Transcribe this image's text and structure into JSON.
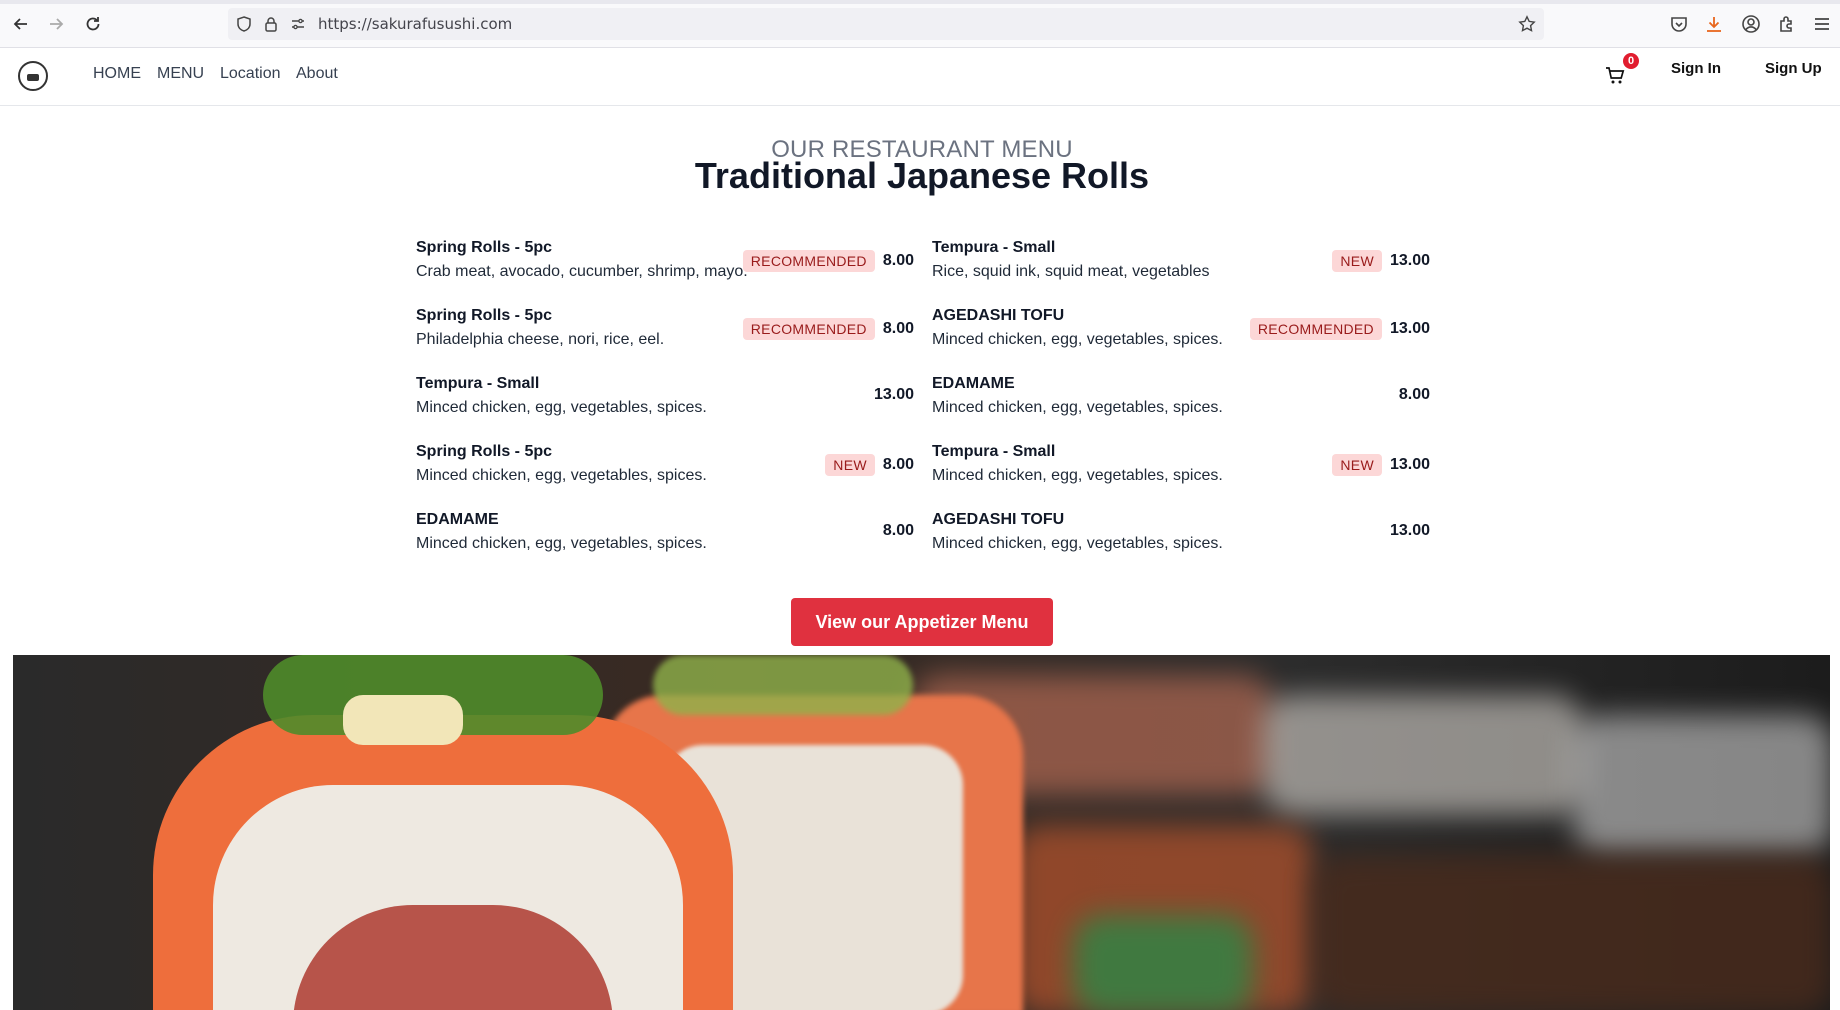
{
  "browser": {
    "url": "https://sakurafusushi.com"
  },
  "nav": {
    "links": [
      "HOME",
      "MENU",
      "Location",
      "About"
    ],
    "cart_count": "0",
    "sign_in": "Sign In",
    "sign_up": "Sign Up"
  },
  "menu": {
    "kicker": "OUR RESTAURANT MENU",
    "title": "Traditional Japanese Rolls",
    "left": [
      {
        "name": "Spring Rolls - 5pc",
        "desc": "Crab meat, avocado, cucumber, shrimp, mayo.",
        "badge": "RECOMMENDED",
        "price": "8.00"
      },
      {
        "name": "Spring Rolls - 5pc",
        "desc": "Philadelphia cheese, nori, rice, eel.",
        "badge": "RECOMMENDED",
        "price": "8.00"
      },
      {
        "name": "Tempura - Small",
        "desc": "Minced chicken, egg, vegetables, spices.",
        "badge": "",
        "price": "13.00"
      },
      {
        "name": "Spring Rolls - 5pc",
        "desc": "Minced chicken, egg, vegetables, spices.",
        "badge": "NEW",
        "price": "8.00"
      },
      {
        "name": "EDAMAME",
        "desc": "Minced chicken, egg, vegetables, spices.",
        "badge": "",
        "price": "8.00"
      }
    ],
    "right": [
      {
        "name": "Tempura - Small",
        "desc": "Rice, squid ink, squid meat, vegetables",
        "badge": "NEW",
        "price": "13.00"
      },
      {
        "name": "AGEDASHI TOFU",
        "desc": "Minced chicken, egg, vegetables, spices.",
        "badge": "RECOMMENDED",
        "price": "13.00"
      },
      {
        "name": "EDAMAME",
        "desc": "Minced chicken, egg, vegetables, spices.",
        "badge": "",
        "price": "8.00"
      },
      {
        "name": "Tempura - Small",
        "desc": "Minced chicken, egg, vegetables, spices.",
        "badge": "NEW",
        "price": "13.00"
      },
      {
        "name": "AGEDASHI TOFU",
        "desc": "Minced chicken, egg, vegetables, spices.",
        "badge": "",
        "price": "13.00"
      }
    ],
    "cta_label": "View our Appetizer Menu"
  },
  "colors": {
    "accent": "#e0313f",
    "badge_bg": "#fcd7d7",
    "badge_text": "#991b1b"
  },
  "icons": [
    "back-arrow-icon",
    "forward-arrow-icon",
    "reload-icon",
    "shield-icon",
    "lock-icon",
    "site-settings-icon",
    "bookmark-star-icon",
    "pocket-icon",
    "download-icon",
    "account-icon",
    "extensions-icon",
    "hamburger-menu-icon",
    "cart-icon"
  ]
}
